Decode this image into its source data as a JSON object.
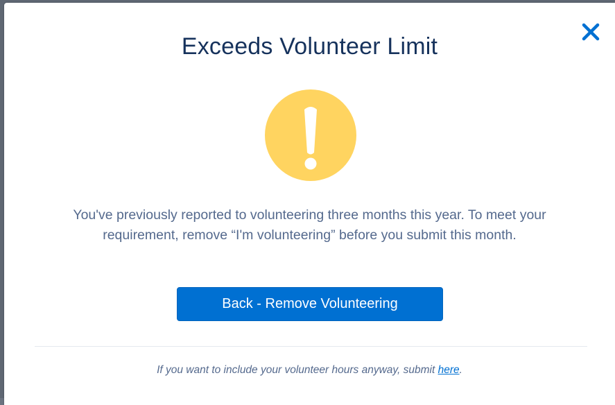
{
  "modal": {
    "title": "Exceeds Volunteer Limit",
    "close_icon": "close-icon",
    "warning_icon": "warning-exclamation-icon",
    "message": "You've previously reported to volunteering three months this year. To meet your requirement, remove “I'm volunteering” before you submit this month.",
    "primary_button_label": "Back - Remove Volunteering",
    "footer_text": "If you want to include your volunteer hours anyway, submit ",
    "footer_link": "here",
    "footer_suffix": "."
  },
  "colors": {
    "brand": "#0070d2",
    "title": "#16325c",
    "body_text": "#54698d",
    "warning": "#ffd460"
  }
}
